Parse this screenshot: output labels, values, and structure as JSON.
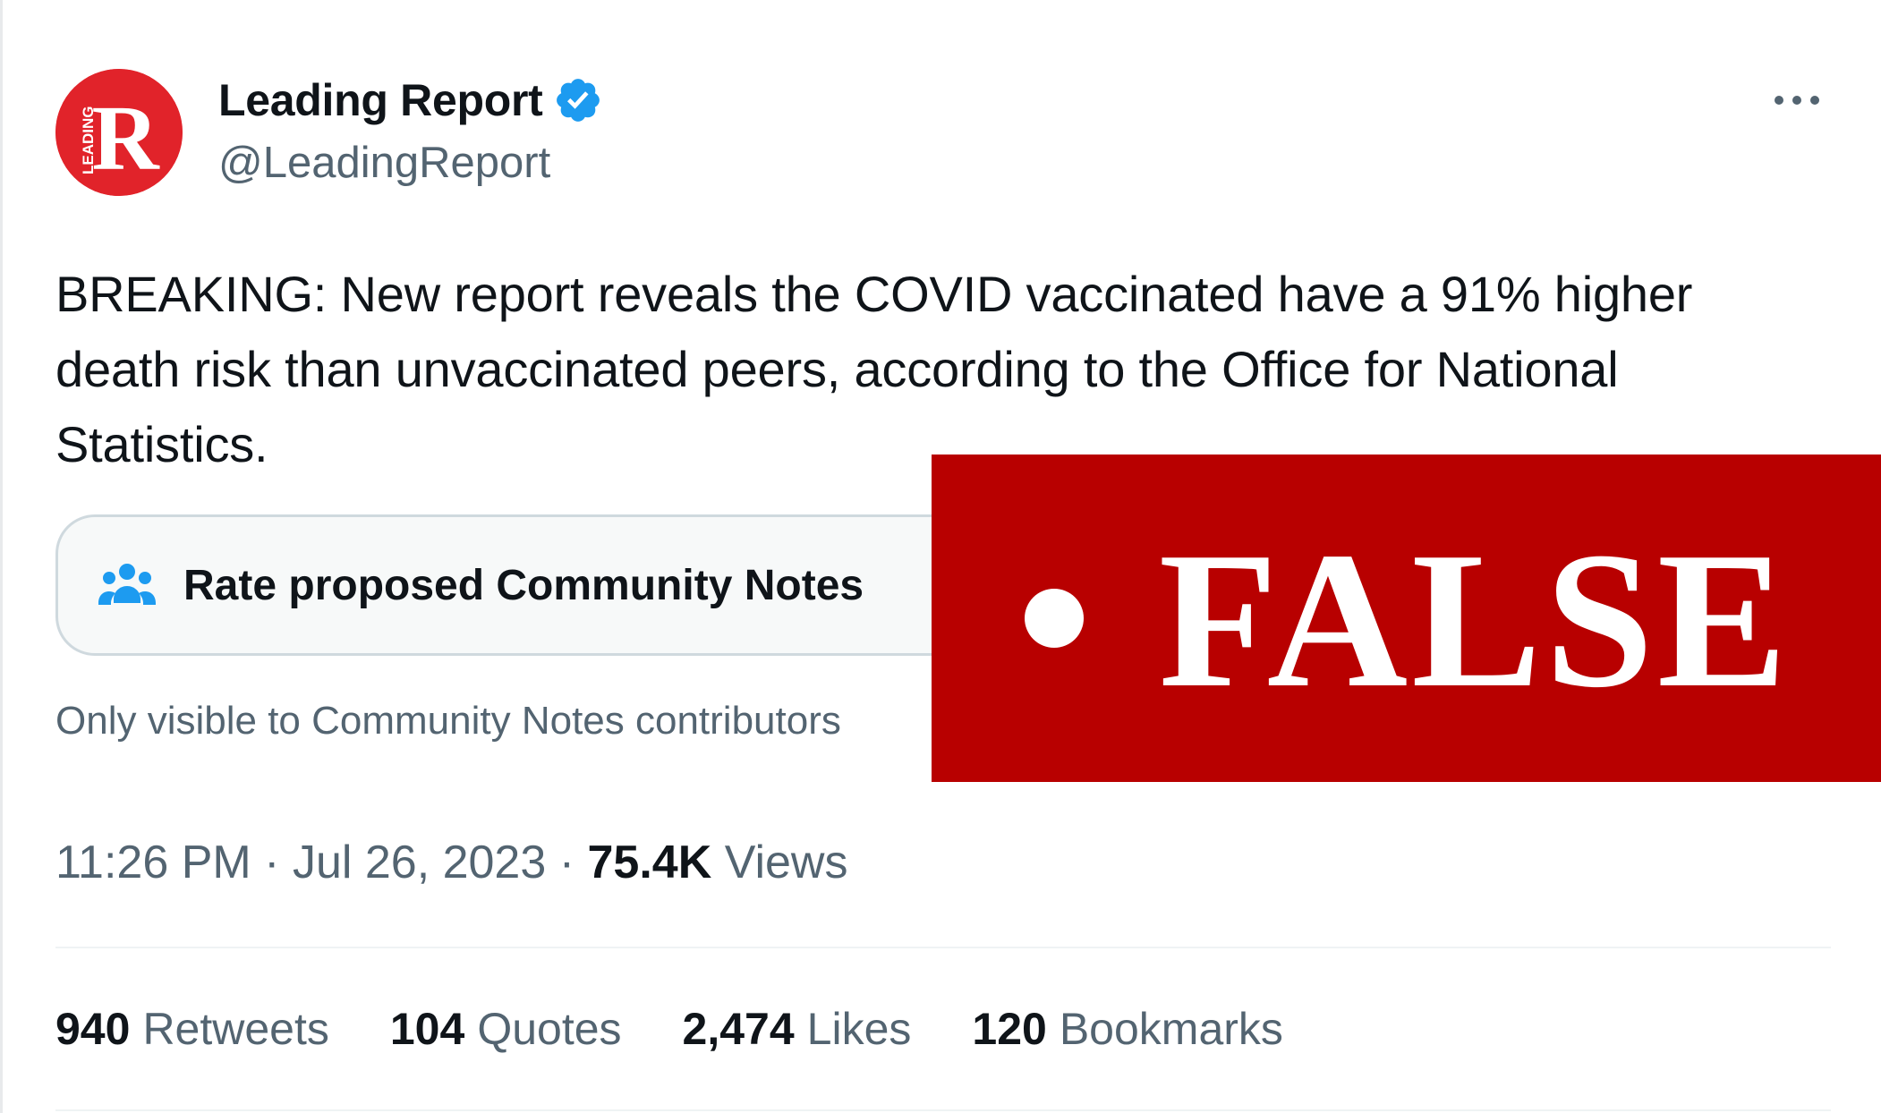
{
  "author": {
    "name": "Leading Report",
    "handle": "@LeadingReport",
    "avatar_letter": "R",
    "avatar_side_text": "LEADING",
    "verified": true,
    "brand_color": "#e1232a",
    "verified_color": "#1d9bf0"
  },
  "tweet": {
    "text": "BREAKING: New report reveals the COVID vaccinated have a 91% higher death risk than unvaccinated peers, according to the Office for National Statistics."
  },
  "community_notes": {
    "button_label": "Rate proposed Community Notes",
    "icon": "people-icon",
    "subtext": "Only visible to Community Notes contributors",
    "icon_color": "#1d9bf0"
  },
  "overlay": {
    "label": "FALSE",
    "color": "#b80000"
  },
  "meta": {
    "time": "11:26 PM",
    "separator": " · ",
    "date": "Jul 26, 2023",
    "views_count": "75.4K",
    "views_label": "Views"
  },
  "stats": [
    {
      "count": "940",
      "label": "Retweets"
    },
    {
      "count": "104",
      "label": "Quotes"
    },
    {
      "count": "2,474",
      "label": "Likes"
    },
    {
      "count": "120",
      "label": "Bookmarks"
    }
  ],
  "icons": {
    "more": "more-horizontal-icon",
    "verified": "verified-badge-icon"
  }
}
